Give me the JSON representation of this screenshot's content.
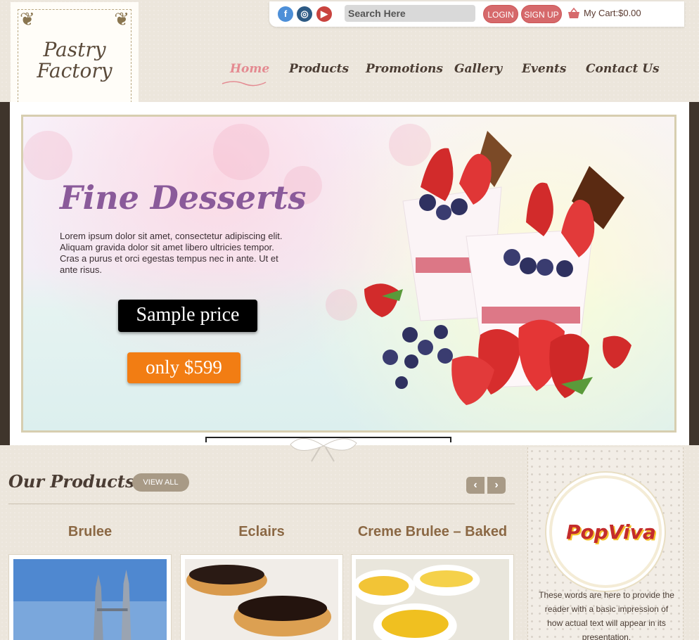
{
  "colors": {
    "accent_pink": "#d6696b",
    "nav_active": "#e48a91",
    "hero_title": "#8a5a9a",
    "price_orange": "#f27d13",
    "product_title": "#8b6844"
  },
  "topbar": {
    "social": [
      {
        "icon": "facebook-icon",
        "glyph": "f"
      },
      {
        "icon": "instagram-icon",
        "glyph": "◎"
      },
      {
        "icon": "youtube-icon",
        "glyph": "▶"
      }
    ],
    "search_placeholder": "Search Here",
    "login_label": "LOGIN",
    "signup_label": "SIGN UP",
    "cart_icon": "basket-icon",
    "cart_text": "My Cart:$0.00"
  },
  "logo": {
    "line1": "Pastry",
    "line2": "Factory"
  },
  "nav": {
    "items": [
      {
        "label": "Home",
        "active": true
      },
      {
        "label": "Products"
      },
      {
        "label": "Promotions"
      },
      {
        "label": "Gallery"
      },
      {
        "label": "Events"
      },
      {
        "label": "Contact Us"
      }
    ]
  },
  "hero": {
    "title": "Fine Desserts",
    "body": "Lorem ipsum dolor sit amet, consectetur adipiscing elit. Aliquam gravida dolor sit amet libero ultricies tempor. Cras a purus et orci egestas tempus nec in ante. Ut et ante risus.",
    "sample_label": "Sample price",
    "price_label": "only $599"
  },
  "products": {
    "title": "Our Products",
    "view_all_label": "VIEW ALL",
    "prev_glyph": "‹",
    "next_glyph": "›",
    "items": [
      {
        "name": "Brulee"
      },
      {
        "name": "Eclairs"
      },
      {
        "name": "Creme Brulee – Baked"
      }
    ]
  },
  "sidebar": {
    "badge_text": "PopViva",
    "text": "These words are here to provide the reader with a basic impression of how actual text will appear in its presentation."
  }
}
